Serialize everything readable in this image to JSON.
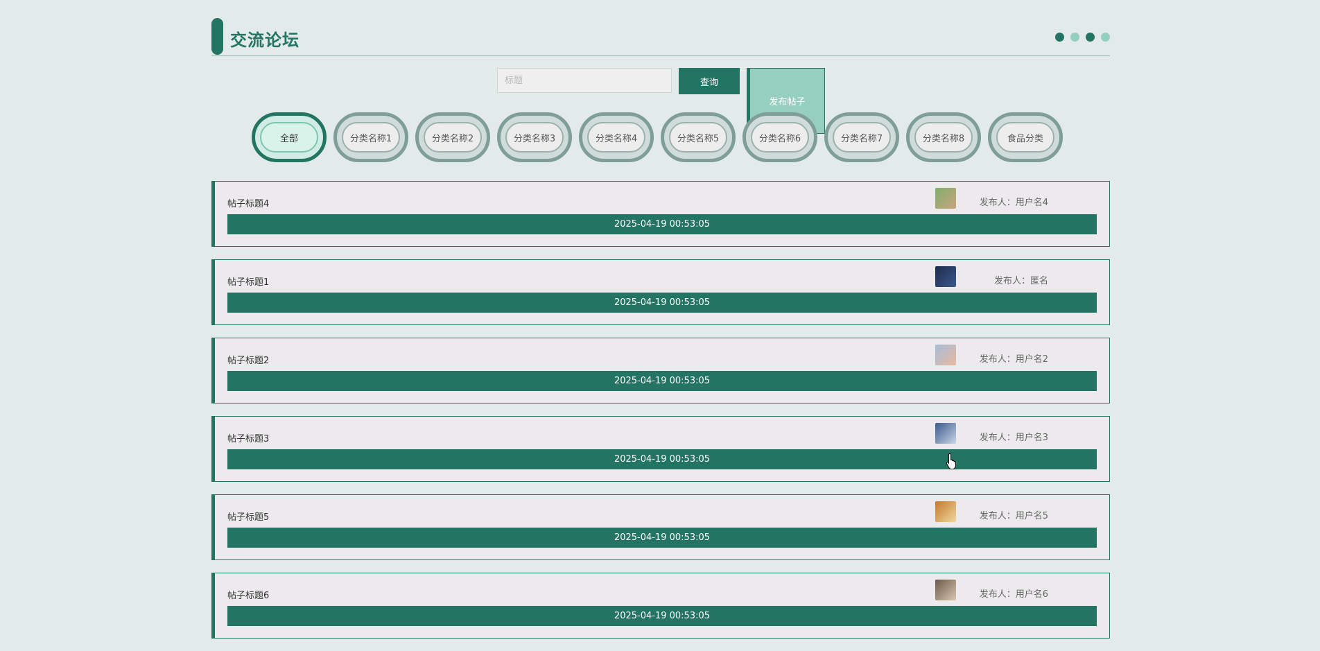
{
  "header": {
    "title": "交流论坛",
    "dots": [
      "#237463",
      "#97cfbf",
      "#237463",
      "#97cfbf"
    ]
  },
  "search": {
    "placeholder": "标题",
    "query_label": "查询",
    "post_label": "发布帖子"
  },
  "categories": [
    {
      "label": "全部",
      "active": true
    },
    {
      "label": "分类名称1"
    },
    {
      "label": "分类名称2"
    },
    {
      "label": "分类名称3"
    },
    {
      "label": "分类名称4"
    },
    {
      "label": "分类名称5"
    },
    {
      "label": "分类名称6"
    },
    {
      "label": "分类名称7"
    },
    {
      "label": "分类名称8"
    },
    {
      "label": "食品分类"
    }
  ],
  "posts": [
    {
      "title": "帖子标题4",
      "author_label": "发布人：",
      "author": "用户名4",
      "date": "2025-04-19 00:53:05",
      "avatar_colors": [
        "#7fb06a",
        "#c9a47e"
      ]
    },
    {
      "title": "帖子标题1",
      "author_label": "发布人：",
      "author": "匿名",
      "date": "2025-04-19 00:53:05",
      "avatar_colors": [
        "#1e2b4e",
        "#3a5a8a"
      ]
    },
    {
      "title": "帖子标题2",
      "author_label": "发布人：",
      "author": "用户名2",
      "date": "2025-04-19 00:53:05",
      "avatar_colors": [
        "#a6bdd8",
        "#e7b9a0"
      ]
    },
    {
      "title": "帖子标题3",
      "author_label": "发布人：",
      "author": "用户名3",
      "date": "2025-04-19 00:53:05",
      "avatar_colors": [
        "#3a5a8e",
        "#c8d4e4"
      ]
    },
    {
      "title": "帖子标题5",
      "author_label": "发布人：",
      "author": "用户名5",
      "date": "2025-04-19 00:53:05",
      "avatar_colors": [
        "#c27a2a",
        "#f1d7a0"
      ]
    },
    {
      "title": "帖子标题6",
      "author_label": "发布人：",
      "author": "用户名6",
      "date": "2025-04-19 00:53:05",
      "avatar_colors": [
        "#6b5a4a",
        "#d9c7b2"
      ]
    }
  ]
}
